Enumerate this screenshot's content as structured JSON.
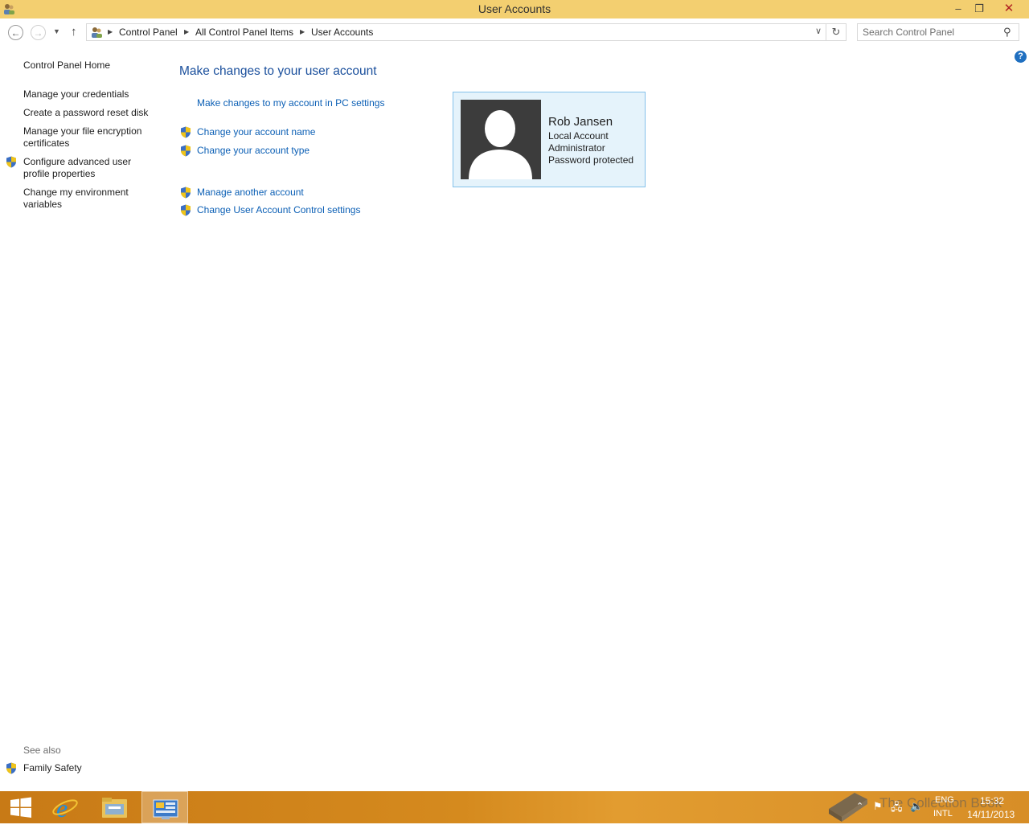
{
  "window": {
    "title": "User Accounts",
    "minimize_glyph": "‒",
    "maximize_glyph": "❐",
    "close_glyph": "✕"
  },
  "nav": {
    "back_glyph": "←",
    "forward_glyph": "→",
    "recent_glyph": "▼",
    "up_glyph": "↑",
    "refresh_glyph": "↻",
    "dropdown_glyph": "∨"
  },
  "breadcrumb": [
    "Control Panel",
    "All Control Panel Items",
    "User Accounts"
  ],
  "search": {
    "placeholder": "Search Control Panel",
    "icon_glyph": "⚲"
  },
  "help_glyph": "?",
  "sidebar": {
    "items": [
      {
        "label": "Control Panel Home",
        "shield": false
      },
      {
        "label": "Manage your credentials",
        "shield": false
      },
      {
        "label": "Create a password reset disk",
        "shield": false
      },
      {
        "label": "Manage your file encryption certificates",
        "shield": false
      },
      {
        "label": "Configure advanced user profile properties",
        "shield": true
      },
      {
        "label": "Change my environment variables",
        "shield": false
      }
    ],
    "see_also": {
      "title": "See also",
      "items": [
        {
          "label": "Family Safety",
          "shield": true
        }
      ]
    }
  },
  "main": {
    "heading": "Make changes to your user account",
    "tasks": [
      {
        "label": "Make changes to my account in PC settings",
        "shield": false
      },
      {
        "label": "Change your account name",
        "shield": true
      },
      {
        "label": "Change your account type",
        "shield": true
      },
      {
        "label": "Manage another account",
        "shield": true
      },
      {
        "label": "Change User Account Control settings",
        "shield": true
      }
    ]
  },
  "account": {
    "name": "Rob Jansen",
    "type": "Local Account",
    "role": "Administrator",
    "status": "Password protected"
  },
  "taskbar": {
    "apps": [
      "start-button",
      "internet-explorer",
      "file-explorer",
      "control-panel"
    ],
    "active_app": "control-panel",
    "lang_top": "ENG",
    "lang_bottom": "INTL",
    "time": "15:32",
    "date": "14/11/2013",
    "watermark": "The Collection Book"
  },
  "colors": {
    "titlebar": "#f3cf70",
    "link": "#0b5fb5",
    "heading": "#1a4f9c",
    "card_bg": "#e5f3fb",
    "card_border": "#84c1ea",
    "taskbar": "#d58a1e"
  }
}
